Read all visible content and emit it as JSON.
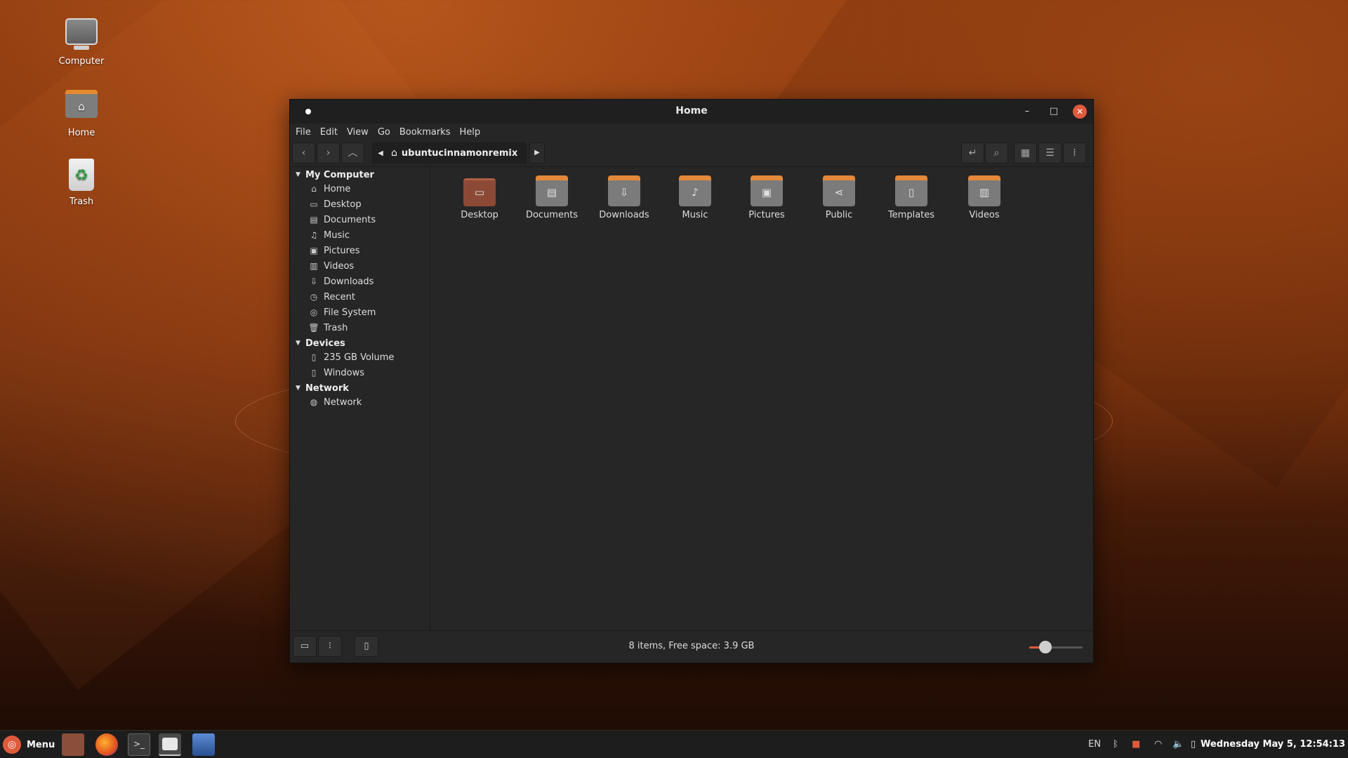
{
  "desktop": {
    "icons": [
      {
        "label": "Computer",
        "icon": "computer-icon"
      },
      {
        "label": "Home",
        "icon": "home-folder-icon"
      },
      {
        "label": "Trash",
        "icon": "trash-icon"
      }
    ]
  },
  "window": {
    "title": "Home",
    "menu": [
      "File",
      "Edit",
      "View",
      "Go",
      "Bookmarks",
      "Help"
    ],
    "breadcrumb": "ubuntucinnamonremix",
    "sidebar": {
      "sections": [
        {
          "title": "My Computer",
          "items": [
            "Home",
            "Desktop",
            "Documents",
            "Music",
            "Pictures",
            "Videos",
            "Downloads",
            "Recent",
            "File System",
            "Trash"
          ]
        },
        {
          "title": "Devices",
          "items": [
            "235 GB Volume",
            "Windows"
          ]
        },
        {
          "title": "Network",
          "items": [
            "Network"
          ]
        }
      ]
    },
    "files": [
      "Desktop",
      "Documents",
      "Downloads",
      "Music",
      "Pictures",
      "Public",
      "Templates",
      "Videos"
    ],
    "status": "8 items, Free space: 3.9 GB",
    "zoom_level": 0.3
  },
  "taskbar": {
    "menu_label": "Menu",
    "keyboard_layout": "EN",
    "clock": "Wednesday May  5, 12:54:13"
  }
}
